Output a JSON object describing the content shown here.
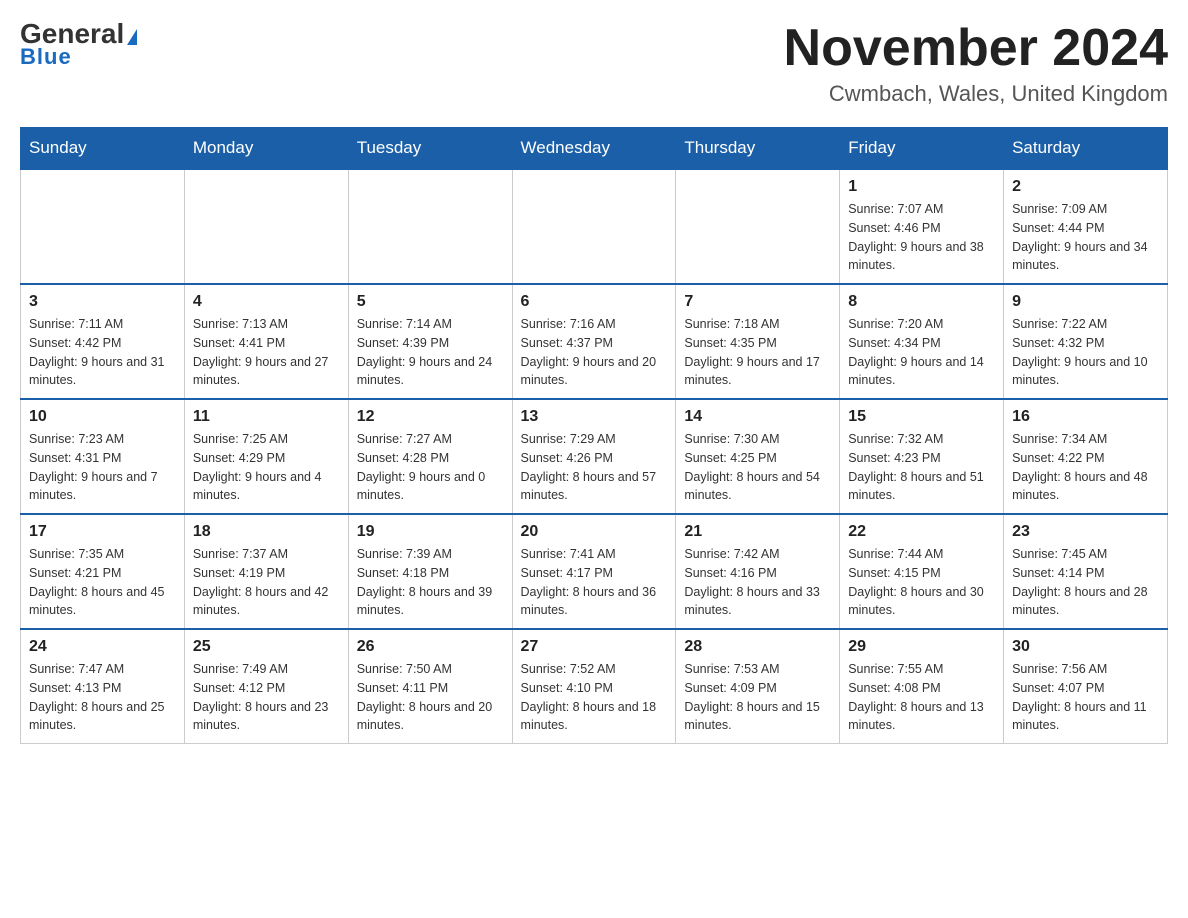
{
  "header": {
    "logo_main": "General",
    "logo_sub": "Blue",
    "title": "November 2024",
    "subtitle": "Cwmbach, Wales, United Kingdom"
  },
  "weekdays": [
    "Sunday",
    "Monday",
    "Tuesday",
    "Wednesday",
    "Thursday",
    "Friday",
    "Saturday"
  ],
  "rows": [
    [
      {
        "day": "",
        "sunrise": "",
        "sunset": "",
        "daylight": ""
      },
      {
        "day": "",
        "sunrise": "",
        "sunset": "",
        "daylight": ""
      },
      {
        "day": "",
        "sunrise": "",
        "sunset": "",
        "daylight": ""
      },
      {
        "day": "",
        "sunrise": "",
        "sunset": "",
        "daylight": ""
      },
      {
        "day": "",
        "sunrise": "",
        "sunset": "",
        "daylight": ""
      },
      {
        "day": "1",
        "sunrise": "Sunrise: 7:07 AM",
        "sunset": "Sunset: 4:46 PM",
        "daylight": "Daylight: 9 hours and 38 minutes."
      },
      {
        "day": "2",
        "sunrise": "Sunrise: 7:09 AM",
        "sunset": "Sunset: 4:44 PM",
        "daylight": "Daylight: 9 hours and 34 minutes."
      }
    ],
    [
      {
        "day": "3",
        "sunrise": "Sunrise: 7:11 AM",
        "sunset": "Sunset: 4:42 PM",
        "daylight": "Daylight: 9 hours and 31 minutes."
      },
      {
        "day": "4",
        "sunrise": "Sunrise: 7:13 AM",
        "sunset": "Sunset: 4:41 PM",
        "daylight": "Daylight: 9 hours and 27 minutes."
      },
      {
        "day": "5",
        "sunrise": "Sunrise: 7:14 AM",
        "sunset": "Sunset: 4:39 PM",
        "daylight": "Daylight: 9 hours and 24 minutes."
      },
      {
        "day": "6",
        "sunrise": "Sunrise: 7:16 AM",
        "sunset": "Sunset: 4:37 PM",
        "daylight": "Daylight: 9 hours and 20 minutes."
      },
      {
        "day": "7",
        "sunrise": "Sunrise: 7:18 AM",
        "sunset": "Sunset: 4:35 PM",
        "daylight": "Daylight: 9 hours and 17 minutes."
      },
      {
        "day": "8",
        "sunrise": "Sunrise: 7:20 AM",
        "sunset": "Sunset: 4:34 PM",
        "daylight": "Daylight: 9 hours and 14 minutes."
      },
      {
        "day": "9",
        "sunrise": "Sunrise: 7:22 AM",
        "sunset": "Sunset: 4:32 PM",
        "daylight": "Daylight: 9 hours and 10 minutes."
      }
    ],
    [
      {
        "day": "10",
        "sunrise": "Sunrise: 7:23 AM",
        "sunset": "Sunset: 4:31 PM",
        "daylight": "Daylight: 9 hours and 7 minutes."
      },
      {
        "day": "11",
        "sunrise": "Sunrise: 7:25 AM",
        "sunset": "Sunset: 4:29 PM",
        "daylight": "Daylight: 9 hours and 4 minutes."
      },
      {
        "day": "12",
        "sunrise": "Sunrise: 7:27 AM",
        "sunset": "Sunset: 4:28 PM",
        "daylight": "Daylight: 9 hours and 0 minutes."
      },
      {
        "day": "13",
        "sunrise": "Sunrise: 7:29 AM",
        "sunset": "Sunset: 4:26 PM",
        "daylight": "Daylight: 8 hours and 57 minutes."
      },
      {
        "day": "14",
        "sunrise": "Sunrise: 7:30 AM",
        "sunset": "Sunset: 4:25 PM",
        "daylight": "Daylight: 8 hours and 54 minutes."
      },
      {
        "day": "15",
        "sunrise": "Sunrise: 7:32 AM",
        "sunset": "Sunset: 4:23 PM",
        "daylight": "Daylight: 8 hours and 51 minutes."
      },
      {
        "day": "16",
        "sunrise": "Sunrise: 7:34 AM",
        "sunset": "Sunset: 4:22 PM",
        "daylight": "Daylight: 8 hours and 48 minutes."
      }
    ],
    [
      {
        "day": "17",
        "sunrise": "Sunrise: 7:35 AM",
        "sunset": "Sunset: 4:21 PM",
        "daylight": "Daylight: 8 hours and 45 minutes."
      },
      {
        "day": "18",
        "sunrise": "Sunrise: 7:37 AM",
        "sunset": "Sunset: 4:19 PM",
        "daylight": "Daylight: 8 hours and 42 minutes."
      },
      {
        "day": "19",
        "sunrise": "Sunrise: 7:39 AM",
        "sunset": "Sunset: 4:18 PM",
        "daylight": "Daylight: 8 hours and 39 minutes."
      },
      {
        "day": "20",
        "sunrise": "Sunrise: 7:41 AM",
        "sunset": "Sunset: 4:17 PM",
        "daylight": "Daylight: 8 hours and 36 minutes."
      },
      {
        "day": "21",
        "sunrise": "Sunrise: 7:42 AM",
        "sunset": "Sunset: 4:16 PM",
        "daylight": "Daylight: 8 hours and 33 minutes."
      },
      {
        "day": "22",
        "sunrise": "Sunrise: 7:44 AM",
        "sunset": "Sunset: 4:15 PM",
        "daylight": "Daylight: 8 hours and 30 minutes."
      },
      {
        "day": "23",
        "sunrise": "Sunrise: 7:45 AM",
        "sunset": "Sunset: 4:14 PM",
        "daylight": "Daylight: 8 hours and 28 minutes."
      }
    ],
    [
      {
        "day": "24",
        "sunrise": "Sunrise: 7:47 AM",
        "sunset": "Sunset: 4:13 PM",
        "daylight": "Daylight: 8 hours and 25 minutes."
      },
      {
        "day": "25",
        "sunrise": "Sunrise: 7:49 AM",
        "sunset": "Sunset: 4:12 PM",
        "daylight": "Daylight: 8 hours and 23 minutes."
      },
      {
        "day": "26",
        "sunrise": "Sunrise: 7:50 AM",
        "sunset": "Sunset: 4:11 PM",
        "daylight": "Daylight: 8 hours and 20 minutes."
      },
      {
        "day": "27",
        "sunrise": "Sunrise: 7:52 AM",
        "sunset": "Sunset: 4:10 PM",
        "daylight": "Daylight: 8 hours and 18 minutes."
      },
      {
        "day": "28",
        "sunrise": "Sunrise: 7:53 AM",
        "sunset": "Sunset: 4:09 PM",
        "daylight": "Daylight: 8 hours and 15 minutes."
      },
      {
        "day": "29",
        "sunrise": "Sunrise: 7:55 AM",
        "sunset": "Sunset: 4:08 PM",
        "daylight": "Daylight: 8 hours and 13 minutes."
      },
      {
        "day": "30",
        "sunrise": "Sunrise: 7:56 AM",
        "sunset": "Sunset: 4:07 PM",
        "daylight": "Daylight: 8 hours and 11 minutes."
      }
    ]
  ]
}
